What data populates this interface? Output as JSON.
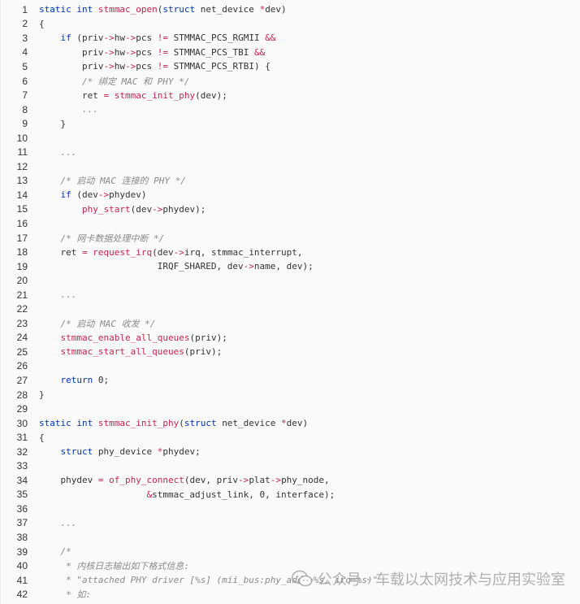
{
  "code": {
    "lines": [
      {
        "n": "1",
        "segs": [
          [
            "kw",
            "static "
          ],
          [
            "kw",
            "int "
          ],
          [
            "fn",
            "stmmac_open"
          ],
          [
            "t",
            "("
          ],
          [
            "kw",
            "struct "
          ],
          [
            "t",
            "net_device "
          ],
          [
            "op",
            "*"
          ],
          [
            "t",
            "dev)"
          ]
        ]
      },
      {
        "n": "2",
        "segs": [
          [
            "t",
            "{"
          ]
        ]
      },
      {
        "n": "3",
        "segs": [
          [
            "t",
            "    "
          ],
          [
            "kw",
            "if "
          ],
          [
            "t",
            "(priv"
          ],
          [
            "op",
            "->"
          ],
          [
            "t",
            "hw"
          ],
          [
            "op",
            "->"
          ],
          [
            "t",
            "pcs "
          ],
          [
            "op",
            "!= "
          ],
          [
            "t",
            "STMMAC_PCS_RGMII "
          ],
          [
            "op",
            "&&"
          ]
        ]
      },
      {
        "n": "4",
        "segs": [
          [
            "t",
            "        priv"
          ],
          [
            "op",
            "->"
          ],
          [
            "t",
            "hw"
          ],
          [
            "op",
            "->"
          ],
          [
            "t",
            "pcs "
          ],
          [
            "op",
            "!= "
          ],
          [
            "t",
            "STMMAC_PCS_TBI "
          ],
          [
            "op",
            "&&"
          ]
        ]
      },
      {
        "n": "5",
        "segs": [
          [
            "t",
            "        priv"
          ],
          [
            "op",
            "->"
          ],
          [
            "t",
            "hw"
          ],
          [
            "op",
            "->"
          ],
          [
            "t",
            "pcs "
          ],
          [
            "op",
            "!= "
          ],
          [
            "t",
            "STMMAC_PCS_RTBI) {"
          ]
        ]
      },
      {
        "n": "6",
        "segs": [
          [
            "t",
            "        "
          ],
          [
            "cm",
            "/* 绑定 MAC 和 PHY */"
          ]
        ]
      },
      {
        "n": "7",
        "segs": [
          [
            "t",
            "        ret "
          ],
          [
            "op",
            "= "
          ],
          [
            "fn",
            "stmmac_init_phy"
          ],
          [
            "t",
            "(dev);"
          ]
        ]
      },
      {
        "n": "8",
        "segs": [
          [
            "t",
            "        "
          ],
          [
            "cm",
            "..."
          ]
        ]
      },
      {
        "n": "9",
        "segs": [
          [
            "t",
            "    }"
          ]
        ]
      },
      {
        "n": "10",
        "segs": []
      },
      {
        "n": "11",
        "segs": [
          [
            "t",
            "    "
          ],
          [
            "cm",
            "..."
          ]
        ]
      },
      {
        "n": "12",
        "segs": []
      },
      {
        "n": "13",
        "segs": [
          [
            "t",
            "    "
          ],
          [
            "cm",
            "/* 启动 MAC 连接的 PHY */"
          ]
        ]
      },
      {
        "n": "14",
        "segs": [
          [
            "t",
            "    "
          ],
          [
            "kw",
            "if "
          ],
          [
            "t",
            "(dev"
          ],
          [
            "op",
            "->"
          ],
          [
            "t",
            "phydev)"
          ]
        ]
      },
      {
        "n": "15",
        "segs": [
          [
            "t",
            "        "
          ],
          [
            "fn",
            "phy_start"
          ],
          [
            "t",
            "(dev"
          ],
          [
            "op",
            "->"
          ],
          [
            "t",
            "phydev);"
          ]
        ]
      },
      {
        "n": "16",
        "segs": []
      },
      {
        "n": "17",
        "segs": [
          [
            "t",
            "    "
          ],
          [
            "cm",
            "/* 网卡数据处理中断 */"
          ]
        ]
      },
      {
        "n": "18",
        "segs": [
          [
            "t",
            "    ret "
          ],
          [
            "op",
            "= "
          ],
          [
            "fn",
            "request_irq"
          ],
          [
            "t",
            "(dev"
          ],
          [
            "op",
            "->"
          ],
          [
            "t",
            "irq, stmmac_interrupt,"
          ]
        ]
      },
      {
        "n": "19",
        "segs": [
          [
            "t",
            "                      IRQF_SHARED, dev"
          ],
          [
            "op",
            "->"
          ],
          [
            "t",
            "name, dev);"
          ]
        ]
      },
      {
        "n": "20",
        "segs": []
      },
      {
        "n": "21",
        "segs": [
          [
            "t",
            "    "
          ],
          [
            "cm",
            "..."
          ]
        ]
      },
      {
        "n": "22",
        "segs": []
      },
      {
        "n": "23",
        "segs": [
          [
            "t",
            "    "
          ],
          [
            "cm",
            "/* 启动 MAC 收发 */"
          ]
        ]
      },
      {
        "n": "24",
        "segs": [
          [
            "t",
            "    "
          ],
          [
            "fn",
            "stmmac_enable_all_queues"
          ],
          [
            "t",
            "(priv);"
          ]
        ]
      },
      {
        "n": "25",
        "segs": [
          [
            "t",
            "    "
          ],
          [
            "fn",
            "stmmac_start_all_queues"
          ],
          [
            "t",
            "(priv);"
          ]
        ]
      },
      {
        "n": "26",
        "segs": []
      },
      {
        "n": "27",
        "segs": [
          [
            "t",
            "    "
          ],
          [
            "kw",
            "return "
          ],
          [
            "num",
            "0"
          ],
          [
            "t",
            ";"
          ]
        ]
      },
      {
        "n": "28",
        "segs": [
          [
            "t",
            "}"
          ]
        ]
      },
      {
        "n": "29",
        "segs": []
      },
      {
        "n": "30",
        "segs": [
          [
            "kw",
            "static "
          ],
          [
            "kw",
            "int "
          ],
          [
            "fn",
            "stmmac_init_phy"
          ],
          [
            "t",
            "("
          ],
          [
            "kw",
            "struct "
          ],
          [
            "t",
            "net_device "
          ],
          [
            "op",
            "*"
          ],
          [
            "t",
            "dev)"
          ]
        ]
      },
      {
        "n": "31",
        "segs": [
          [
            "t",
            "{"
          ]
        ]
      },
      {
        "n": "32",
        "segs": [
          [
            "t",
            "    "
          ],
          [
            "kw",
            "struct "
          ],
          [
            "t",
            "phy_device "
          ],
          [
            "op",
            "*"
          ],
          [
            "t",
            "phydev;"
          ]
        ]
      },
      {
        "n": "33",
        "segs": []
      },
      {
        "n": "34",
        "segs": [
          [
            "t",
            "    phydev "
          ],
          [
            "op",
            "= "
          ],
          [
            "fn",
            "of_phy_connect"
          ],
          [
            "t",
            "(dev, priv"
          ],
          [
            "op",
            "->"
          ],
          [
            "t",
            "plat"
          ],
          [
            "op",
            "->"
          ],
          [
            "t",
            "phy_node,"
          ]
        ]
      },
      {
        "n": "35",
        "segs": [
          [
            "t",
            "                    "
          ],
          [
            "op",
            "&"
          ],
          [
            "t",
            "stmmac_adjust_link, "
          ],
          [
            "num",
            "0"
          ],
          [
            "t",
            ", interface);"
          ]
        ]
      },
      {
        "n": "36",
        "segs": []
      },
      {
        "n": "37",
        "segs": [
          [
            "t",
            "    "
          ],
          [
            "cm",
            "..."
          ]
        ]
      },
      {
        "n": "38",
        "segs": []
      },
      {
        "n": "39",
        "segs": [
          [
            "t",
            "    "
          ],
          [
            "cm",
            "/*"
          ]
        ]
      },
      {
        "n": "40",
        "segs": [
          [
            "t",
            "     "
          ],
          [
            "cm",
            "* 内核日志输出如下格式信息:"
          ]
        ]
      },
      {
        "n": "41",
        "segs": [
          [
            "t",
            "     "
          ],
          [
            "cm",
            "* \"attached PHY driver [%s] (mii_bus:phy_addr=%s, irq=%s)\""
          ]
        ]
      },
      {
        "n": "42",
        "segs": [
          [
            "t",
            "     "
          ],
          [
            "cm",
            "* 如:"
          ]
        ]
      }
    ]
  },
  "watermark": {
    "text": "公众号 · 车载以太网技术与应用实验室",
    "icon": "wechat-icon",
    "color": "#969696"
  }
}
